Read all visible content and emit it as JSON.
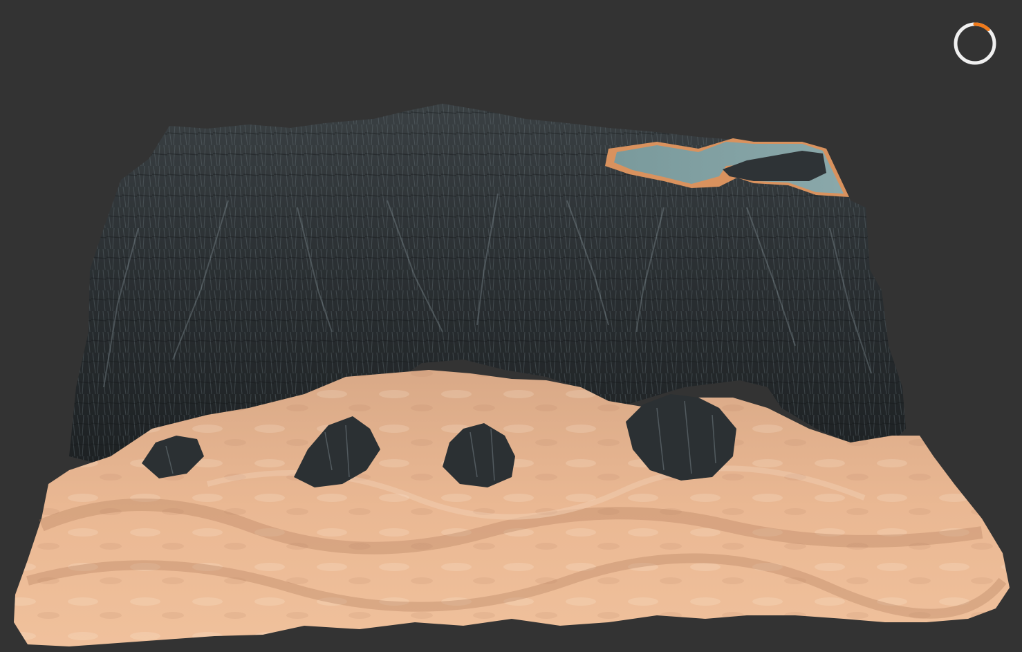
{
  "viewport": {
    "background": "#333333"
  },
  "terrain": {
    "rock_color": "#2a2e31",
    "rock_highlight": "#7d8a90",
    "sand_color": "#e8b58f",
    "sand_shadow": "#b88868",
    "water_color": "#7f9ea0",
    "shore_color": "#d9925e"
  },
  "progress_indicator": {
    "icon": "loading-ring-icon",
    "ring_color": "#f0f0f0",
    "accent_color": "#f07a1a",
    "progress": 0.12
  }
}
